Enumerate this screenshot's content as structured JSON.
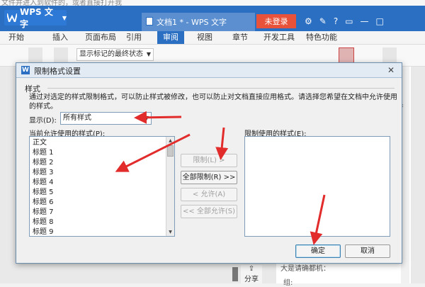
{
  "background": {
    "top_hint": "文件并进入到软件的，或者直接打开我",
    "wps_menu_label": "WPS 文字",
    "doc_tab_title": "文档1 * - WPS 文字",
    "login_button": "未登录",
    "menu_tabs": [
      "开始",
      "插入",
      "页面布局",
      "引用",
      "审阅",
      "视图",
      "章节",
      "开发工具",
      "特色功能"
    ],
    "active_tab": "审阅",
    "ribbon_select": "显示标记的最终状态",
    "share_label": "分享",
    "doc_text_1": "大是请确都机：",
    "doc_text_2": "组:"
  },
  "dialog": {
    "title": "限制格式设置",
    "group_label": "样式",
    "description": "通过对选定的样式限制格式，可以防止样式被修改，也可以防止对文档直接应用格式。请选择您希望在文档中允许使用的样式。",
    "show_label": "显示(D):",
    "show_value": "所有样式",
    "allowed_label": "当前允许使用的样式(P):",
    "allowed_items": [
      "正文",
      "标题 1",
      "标题 2",
      "标题 3",
      "标题 4",
      "标题 5",
      "标题 6",
      "标题 7",
      "标题 8",
      "标题 9"
    ],
    "restricted_label": "限制使用的样式(E):",
    "restricted_items": [],
    "buttons": {
      "restrict": "限制(L) >",
      "restrict_all": "全部限制(R) >>",
      "allow": "< 允许(A)",
      "allow_all": "<< 全部允许(S)",
      "ok": "确定",
      "cancel": "取消"
    }
  },
  "colors": {
    "wps_blue": "#2b6fc2",
    "login_red": "#e8523a",
    "annotation_red": "#e22b2b"
  }
}
